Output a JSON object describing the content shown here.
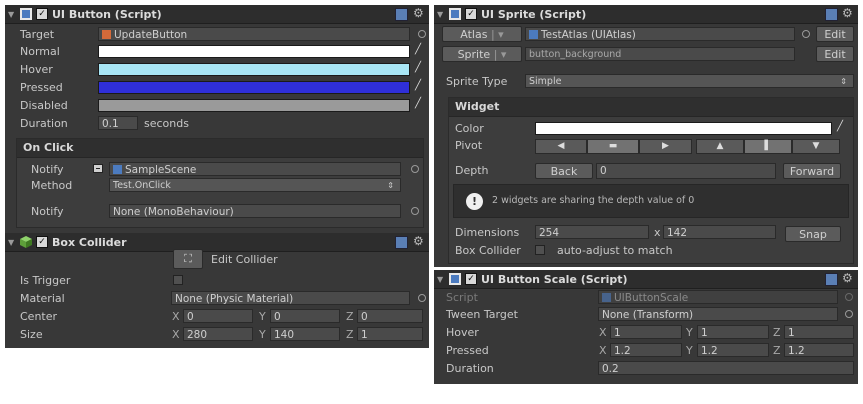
{
  "ui_button": {
    "title": "UI Button (Script)",
    "target_label": "Target",
    "target_value": "UpdateButton",
    "normal_label": "Normal",
    "hover_label": "Hover",
    "pressed_label": "Pressed",
    "disabled_label": "Disabled",
    "colors": {
      "normal": "#ffffff",
      "hover": "#a8e6f5",
      "pressed": "#2f2fd8",
      "disabled": "#9a9a9a"
    },
    "duration_label": "Duration",
    "duration_value": "0.1",
    "duration_unit": "seconds",
    "onclick": {
      "title": "On Click",
      "notify_label": "Notify",
      "notify_value": "SampleScene",
      "method_label": "Method",
      "method_value": "Test.OnClick",
      "notify2_label": "Notify",
      "notify2_value": "None (MonoBehaviour)"
    }
  },
  "box_collider": {
    "title": "Box Collider",
    "edit_label": "Edit Collider",
    "is_trigger_label": "Is Trigger",
    "material_label": "Material",
    "material_value": "None (Physic Material)",
    "center_label": "Center",
    "center": {
      "x": "0",
      "y": "0",
      "z": "0"
    },
    "size_label": "Size",
    "size": {
      "x": "280",
      "y": "140",
      "z": "1"
    }
  },
  "ui_sprite": {
    "title": "UI Sprite (Script)",
    "atlas_label": "Atlas",
    "atlas_value": "TestAtlas (UIAtlas)",
    "atlas_edit": "Edit",
    "sprite_label": "Sprite",
    "sprite_value": "button_background",
    "sprite_edit": "Edit",
    "sprite_type_label": "Sprite Type",
    "sprite_type_value": "Simple",
    "widget": {
      "title": "Widget",
      "color_label": "Color",
      "color": "#ffffff",
      "pivot_label": "Pivot",
      "depth_label": "Depth",
      "back_label": "Back",
      "depth_value": "0",
      "forward_label": "Forward",
      "info_text": "2 widgets are sharing the depth value of 0",
      "dimensions_label": "Dimensions",
      "width": "254",
      "height_prefix": "x",
      "height": "142",
      "snap_label": "Snap",
      "box_collider_label": "Box Collider",
      "auto_adjust_label": "auto-adjust to match"
    }
  },
  "ui_button_scale": {
    "title": "UI Button Scale (Script)",
    "script_label": "Script",
    "script_value": "UIButtonScale",
    "tween_label": "Tween Target",
    "tween_value": "None (Transform)",
    "hover_label": "Hover",
    "hover": {
      "x": "1",
      "y": "1",
      "z": "1"
    },
    "pressed_label": "Pressed",
    "pressed": {
      "x": "1.2",
      "y": "1.2",
      "z": "1.2"
    },
    "duration_label": "Duration",
    "duration_value": "0.2"
  },
  "axis_labels": {
    "x": "X",
    "y": "Y",
    "z": "Z"
  }
}
